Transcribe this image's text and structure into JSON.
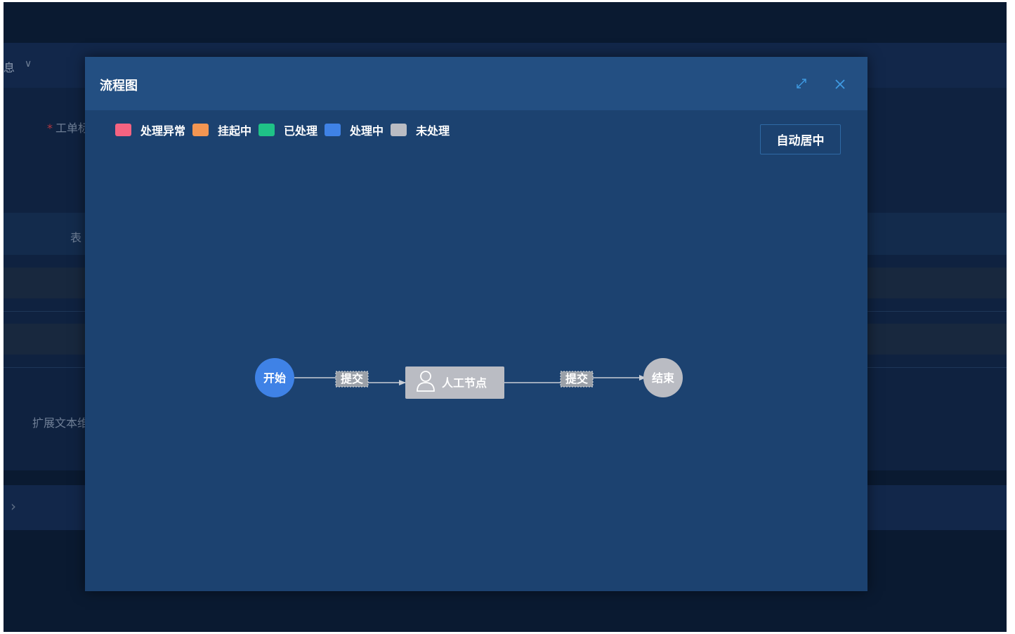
{
  "background": {
    "section_title": "息",
    "fields": {
      "ticket": "工单标",
      "table": "表",
      "ext": "扩展文本维"
    }
  },
  "modal": {
    "title": "流程图",
    "legend": [
      {
        "label": "处理异常",
        "color": "#f46381"
      },
      {
        "label": "挂起中",
        "color": "#f39652"
      },
      {
        "label": "已处理",
        "color": "#1fc287"
      },
      {
        "label": "处理中",
        "color": "#3f82e6"
      },
      {
        "label": "未处理",
        "color": "#babcc3"
      }
    ],
    "center_button": "自动居中",
    "flow": {
      "start_label": "开始",
      "edge1_label": "提交",
      "task_label": "人工节点",
      "edge2_label": "提交",
      "end_label": "结束"
    }
  },
  "colors": {
    "page_bg": "#0a1a31",
    "modal_bg": "#1c4270",
    "modal_header": "#234f82",
    "start_node": "#3f82e6",
    "unprocessed_node": "#babcc3"
  },
  "icons": {
    "expand": "expand-icon",
    "close": "close-icon",
    "user": "user-icon"
  }
}
